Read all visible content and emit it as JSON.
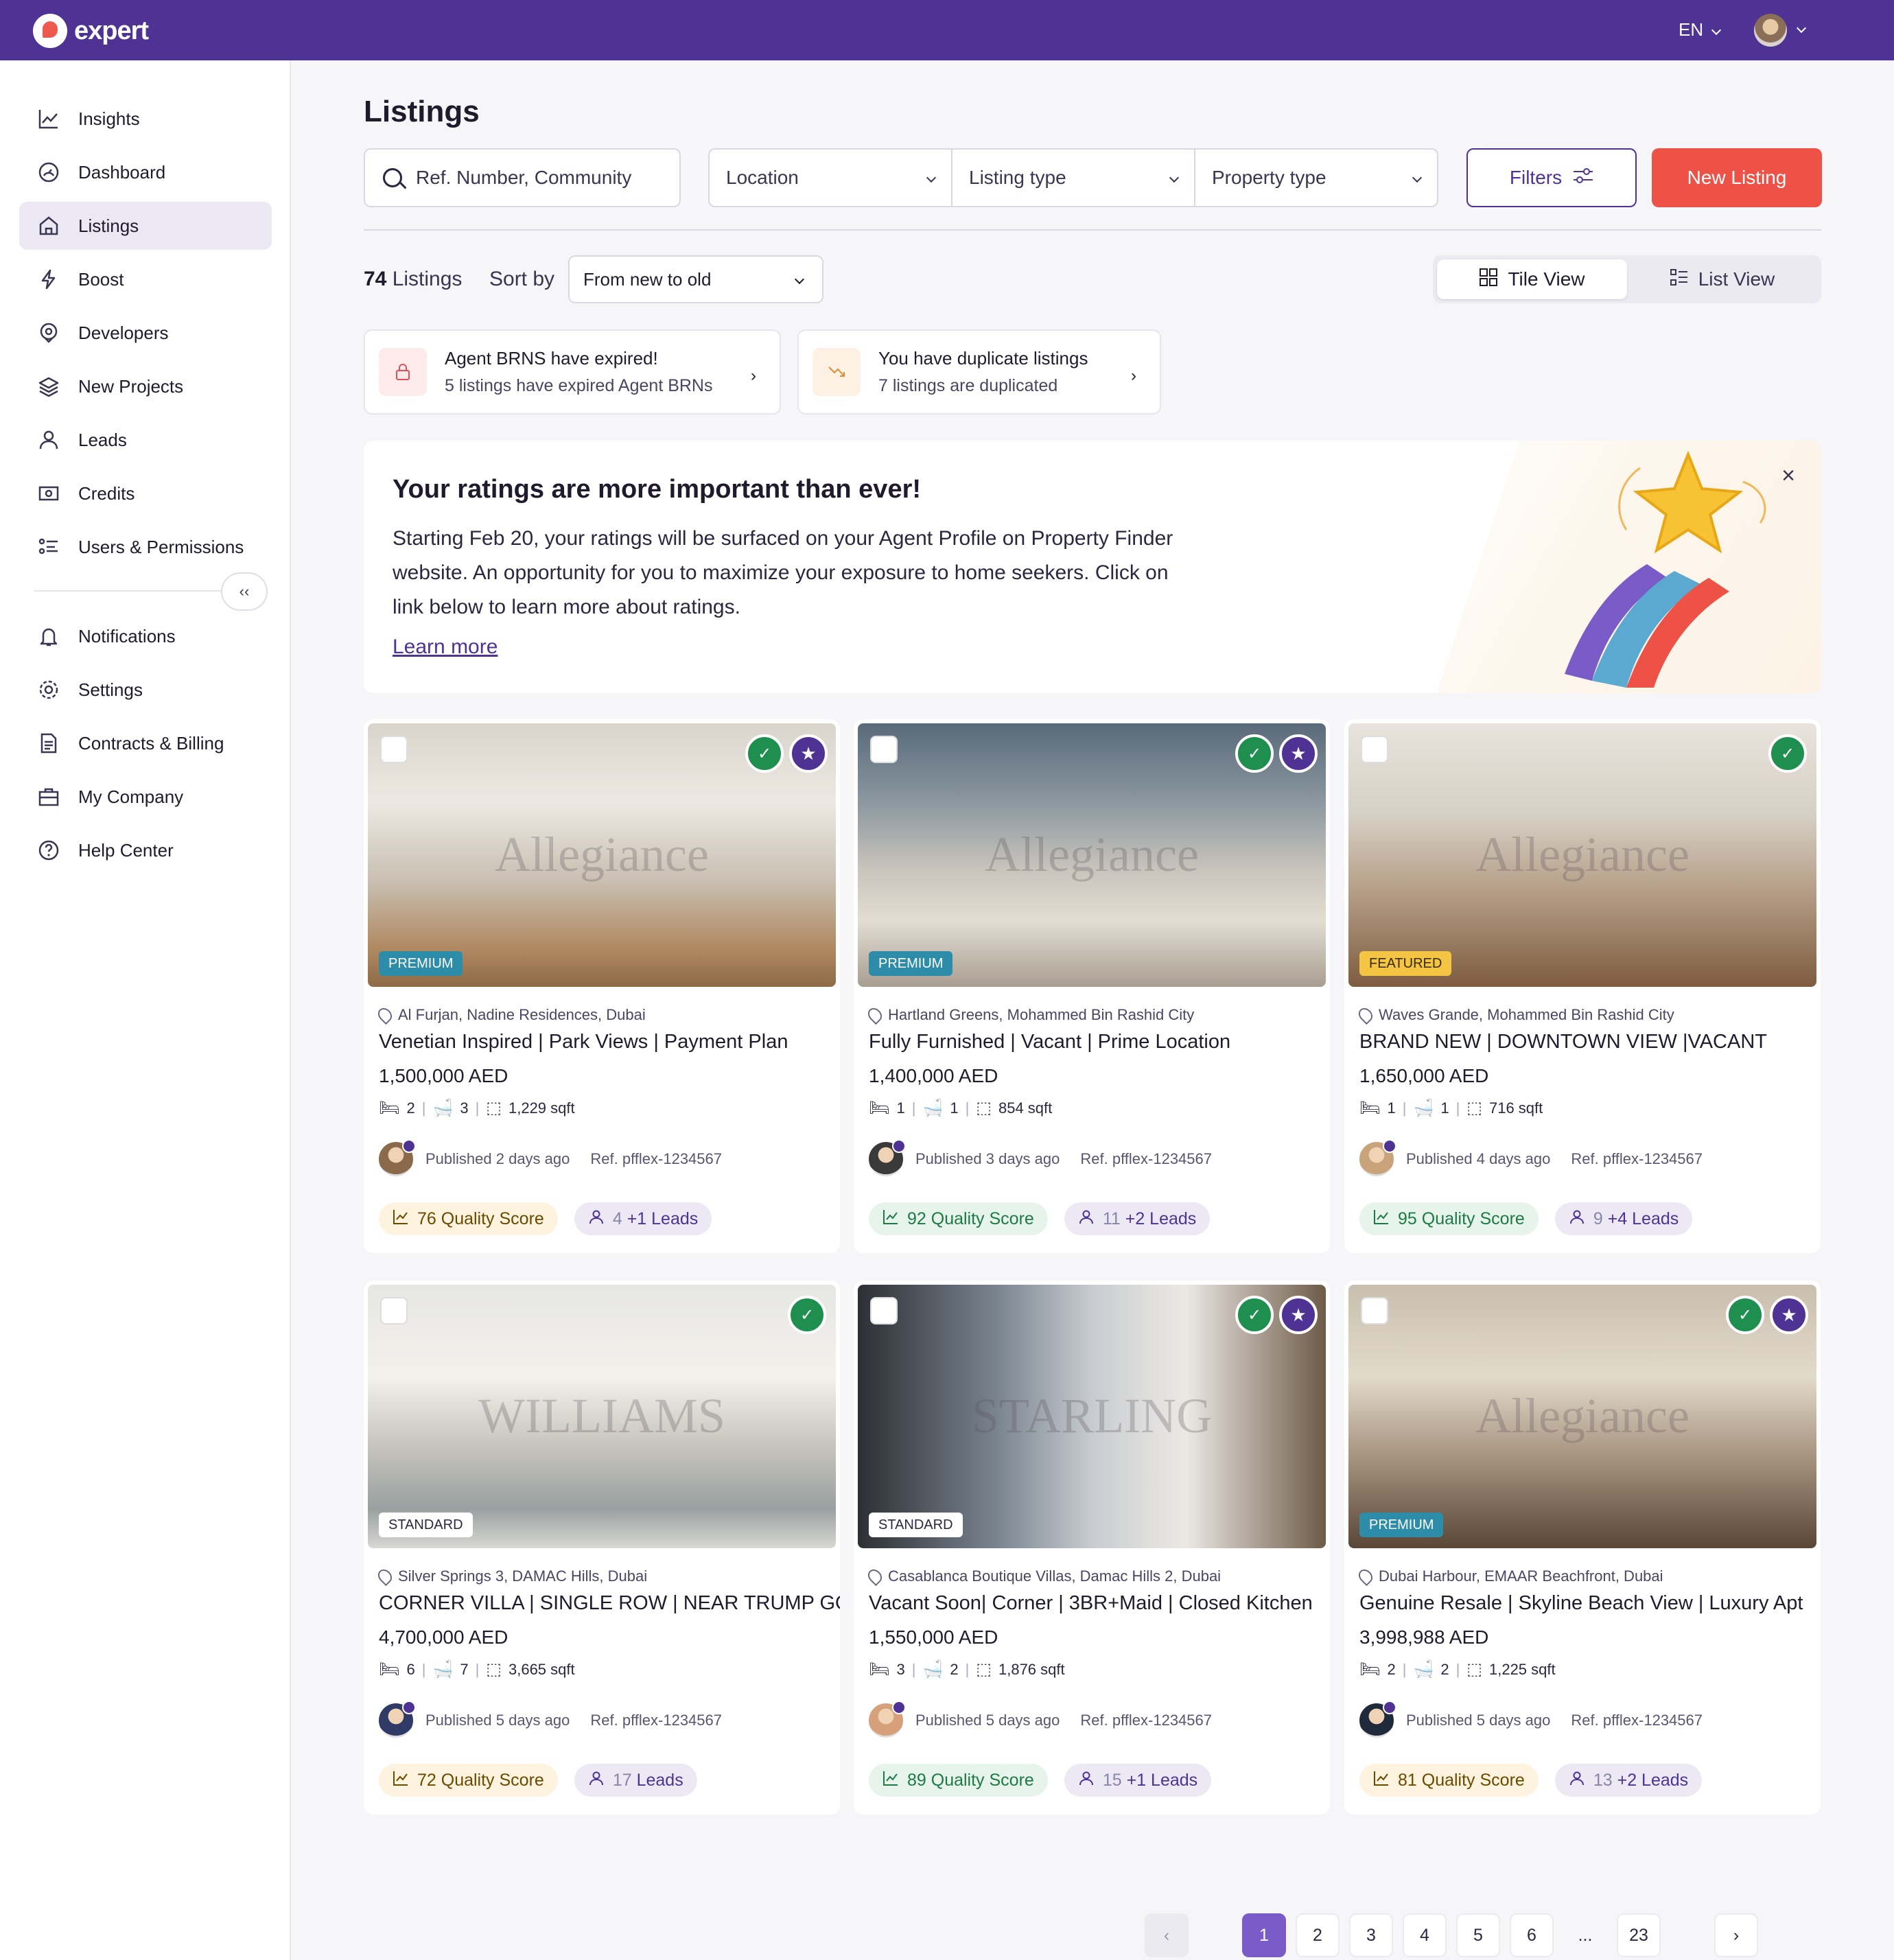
{
  "app": {
    "brand": "expert",
    "lang": "EN"
  },
  "sidebar": {
    "items": [
      {
        "label": "Insights",
        "icon": "chart-line-icon"
      },
      {
        "label": "Dashboard",
        "icon": "gauge-icon"
      },
      {
        "label": "Listings",
        "icon": "home-icon"
      },
      {
        "label": "Boost",
        "icon": "lightning-icon"
      },
      {
        "label": "Developers",
        "icon": "location-badge-icon"
      },
      {
        "label": "New Projects",
        "icon": "layers-icon"
      },
      {
        "label": "Leads",
        "icon": "user-icon"
      },
      {
        "label": "Credits",
        "icon": "banknote-icon"
      },
      {
        "label": "Users & Permissions",
        "icon": "list-users-icon"
      }
    ],
    "bottom_items": [
      {
        "label": "Notifications",
        "icon": "bell-icon"
      },
      {
        "label": "Settings",
        "icon": "gear-icon"
      },
      {
        "label": "Contracts & Billing",
        "icon": "document-icon"
      },
      {
        "label": "My Company",
        "icon": "briefcase-icon"
      },
      {
        "label": "Help Center",
        "icon": "question-icon"
      }
    ]
  },
  "page": {
    "title": "Listings"
  },
  "search": {
    "placeholder": "Ref. Number, Community"
  },
  "filters": {
    "location": "Location",
    "listing_type": "Listing type",
    "property_type": "Property type",
    "filters_btn": "Filters",
    "new_btn": "New Listing"
  },
  "toolbar": {
    "count": "74",
    "count_label": " Listings",
    "sort_label": "Sort by",
    "sort_value": "From new to old",
    "tile_view": "Tile View",
    "list_view": "List View"
  },
  "alerts": [
    {
      "title": "Agent BRNS have expired!",
      "sub": "5 listings have expired Agent BRNs"
    },
    {
      "title": "You have duplicate listings",
      "sub": "7 listings are duplicated"
    }
  ],
  "banner": {
    "title": "Your ratings are more important than ever!",
    "text": "Starting Feb 20, your ratings will be surfaced on your Agent Profile on Property Finder website. An opportunity for you to maximize your exposure to home seekers. Click on link below to learn more about ratings.",
    "link": "Learn more"
  },
  "listings": [
    {
      "tier": "PREMIUM",
      "watermark": "Allegiance",
      "location": "Al Furjan, Nadine Residences, Dubai",
      "title": "Venetian Inspired | Park Views | Payment Plan",
      "price": "1,500,000 AED",
      "beds": "2",
      "baths": "3",
      "area": "1,229 sqft",
      "published": "Published  2 days ago",
      "ref": "Ref. pfflex-1234567",
      "quality": "76 Quality Score",
      "leads": "4",
      "leads_extra": "+1 Leads"
    },
    {
      "tier": "PREMIUM",
      "watermark": "Allegiance",
      "location": "Hartland Greens, Mohammed Bin Rashid City",
      "title": "Fully Furnished | Vacant | Prime Location",
      "price": "1,400,000 AED",
      "beds": "1",
      "baths": "1",
      "area": "854 sqft",
      "published": "Published  3 days ago",
      "ref": "Ref. pfflex-1234567",
      "quality": "92 Quality Score",
      "leads": "11",
      "leads_extra": "+2 Leads"
    },
    {
      "tier": "FEATURED",
      "watermark": "Allegiance",
      "location": "Waves Grande, Mohammed Bin Rashid City",
      "title": "BRAND NEW | DOWNTOWN VIEW |VACANT",
      "price": "1,650,000 AED",
      "beds": "1",
      "baths": "1",
      "area": "716 sqft",
      "published": "Published  4 days ago",
      "ref": "Ref. pfflex-1234567",
      "quality": "95 Quality Score",
      "leads": "9",
      "leads_extra": "+4 Leads"
    },
    {
      "tier": "STANDARD",
      "watermark": "WILLIAMS",
      "location": "Silver Springs 3, DAMAC Hills, Dubai",
      "title": "CORNER VILLA | SINGLE ROW | NEAR TRUMP GOLF",
      "price": "4,700,000 AED",
      "beds": "6",
      "baths": "7",
      "area": "3,665 sqft",
      "published": "Published  5 days ago",
      "ref": "Ref. pfflex-1234567",
      "quality": "72 Quality Score",
      "leads": "17",
      "leads_extra": " Leads"
    },
    {
      "tier": "STANDARD",
      "watermark": "STARLING",
      "location": "Casablanca Boutique Villas, Damac Hills 2, Dubai",
      "title": "Vacant Soon| Corner | 3BR+Maid | Closed Kitchen",
      "price": "1,550,000 AED",
      "beds": "3",
      "baths": "2",
      "area": "1,876 sqft",
      "published": "Published  5 days ago",
      "ref": "Ref. pfflex-1234567",
      "quality": "89 Quality Score",
      "leads": "15",
      "leads_extra": "+1 Leads"
    },
    {
      "tier": "PREMIUM",
      "watermark": "Allegiance",
      "location": "Dubai Harbour, EMAAR Beachfront, Dubai",
      "title": "Genuine Resale | Skyline Beach View | Luxury Apt",
      "price": "3,998,988 AED",
      "beds": "2",
      "baths": "2",
      "area": "1,225 sqft",
      "published": "Published  5 days ago",
      "ref": "Ref. pfflex-1234567",
      "quality": "81 Quality Score",
      "leads": "13",
      "leads_extra": "+2 Leads"
    }
  ],
  "pagination": {
    "pages": [
      "1",
      "2",
      "3",
      "4",
      "5",
      "6",
      "...",
      "23"
    ],
    "current": "1"
  }
}
